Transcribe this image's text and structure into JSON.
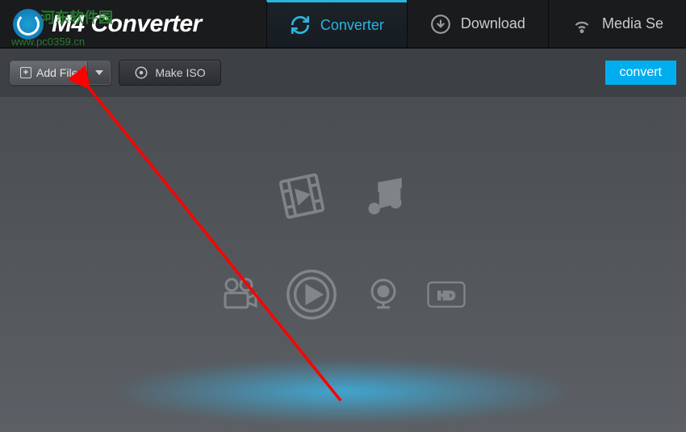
{
  "header": {
    "app_title": "4 Converter",
    "logo_prefix": "M"
  },
  "watermark": {
    "text_cn": "河东软件园",
    "url": "www.pc0359.cn"
  },
  "nav": [
    {
      "label": "Converter",
      "icon": "refresh-icon",
      "active": true
    },
    {
      "label": "Download",
      "icon": "download-icon",
      "active": false
    },
    {
      "label": "Media Se",
      "icon": "wifi-icon",
      "active": false
    }
  ],
  "toolbar": {
    "add_file_label": "Add File",
    "make_iso_label": "Make ISO",
    "convert_label": "convert"
  },
  "colors": {
    "accent": "#2ab5e0",
    "convert_bg": "#00aef0",
    "arrow": "#ff0000"
  }
}
